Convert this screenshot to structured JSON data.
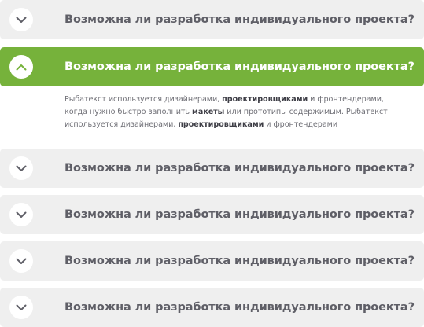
{
  "faq": {
    "items": [
      {
        "question": "Возможна ли разработка индивидуального проекта?",
        "expanded": false
      },
      {
        "question": "Возможна ли разработка индивидуального проекта?",
        "expanded": true
      },
      {
        "question": "Возможна ли разработка индивидуального проекта?",
        "expanded": false
      },
      {
        "question": "Возможна ли разработка индивидуального проекта?",
        "expanded": false
      },
      {
        "question": "Возможна ли разработка индивидуального проекта?",
        "expanded": false
      },
      {
        "question": "Возможна ли разработка индивидуального проекта?",
        "expanded": false
      }
    ],
    "answer": {
      "seg1": "Рыбатекст используется дизайнерами, ",
      "bold1": "проектировщиками",
      "seg2": " и фронтендерами, когда нужно быстро заполнить ",
      "bold2": "макеты",
      "seg3": " или прототипы содержимым. Рыбатекст используется дизайнерами, ",
      "bold3": "проектировщиками",
      "seg4": " и фронтендерами"
    },
    "icons": {
      "collapsed": "chevron-down-icon",
      "expanded": "chevron-up-icon"
    },
    "colors": {
      "accent": "#76b23b",
      "item_bg": "#efefef",
      "question_text": "#5f5f67",
      "icon_color": "#5f5f67"
    }
  }
}
